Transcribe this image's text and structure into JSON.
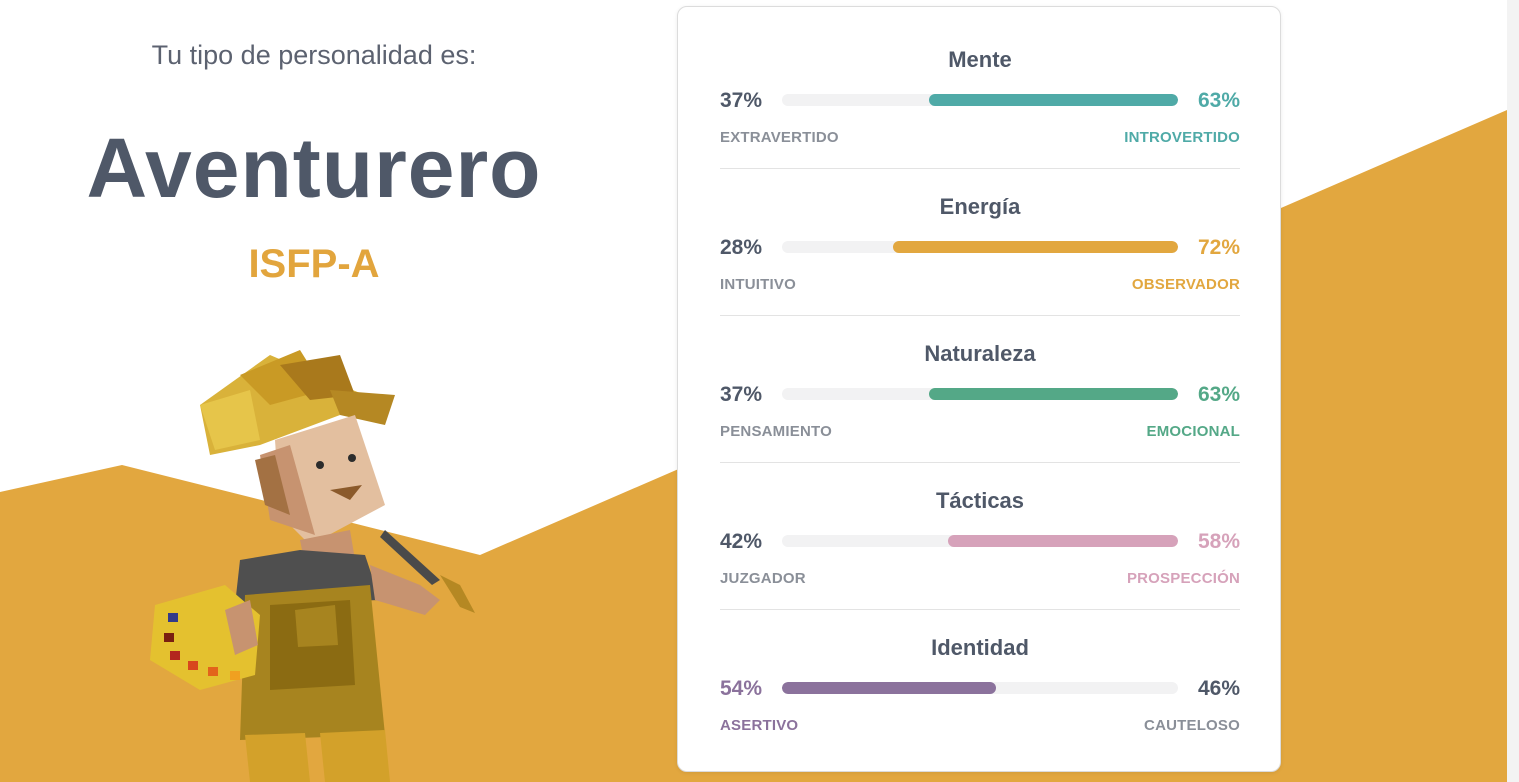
{
  "header": {
    "subtitle": "Tu tipo de personalidad es:",
    "type_name": "Aventurero",
    "type_code": "ISFP-A"
  },
  "colors": {
    "background_shape": "#e2a73f",
    "type_code": "#e2a53d"
  },
  "traits": [
    {
      "title": "Mente",
      "left_label": "EXTRAVERTIDO",
      "right_label": "INTROVERTIDO",
      "left_pct": "37%",
      "right_pct": "63%",
      "dominant": "right",
      "fill_fraction": 0.63,
      "color": "#4faaa7"
    },
    {
      "title": "Energía",
      "left_label": "INTUITIVO",
      "right_label": "OBSERVADOR",
      "left_pct": "28%",
      "right_pct": "72%",
      "dominant": "right",
      "fill_fraction": 0.72,
      "color": "#e2a73f"
    },
    {
      "title": "Naturaleza",
      "left_label": "PENSAMIENTO",
      "right_label": "EMOCIONAL",
      "left_pct": "37%",
      "right_pct": "63%",
      "dominant": "right",
      "fill_fraction": 0.63,
      "color": "#54a887"
    },
    {
      "title": "Tácticas",
      "left_label": "JUZGADOR",
      "right_label": "PROSPECCIÓN",
      "left_pct": "42%",
      "right_pct": "58%",
      "dominant": "right",
      "fill_fraction": 0.58,
      "color": "#d6a2ba"
    },
    {
      "title": "Identidad",
      "left_label": "ASERTIVO",
      "right_label": "CAUTELOSO",
      "left_pct": "54%",
      "right_pct": "46%",
      "dominant": "left",
      "fill_fraction": 0.54,
      "color": "#8b729c"
    }
  ],
  "avatar": {
    "icon": "adventurer-painter-illustration"
  }
}
